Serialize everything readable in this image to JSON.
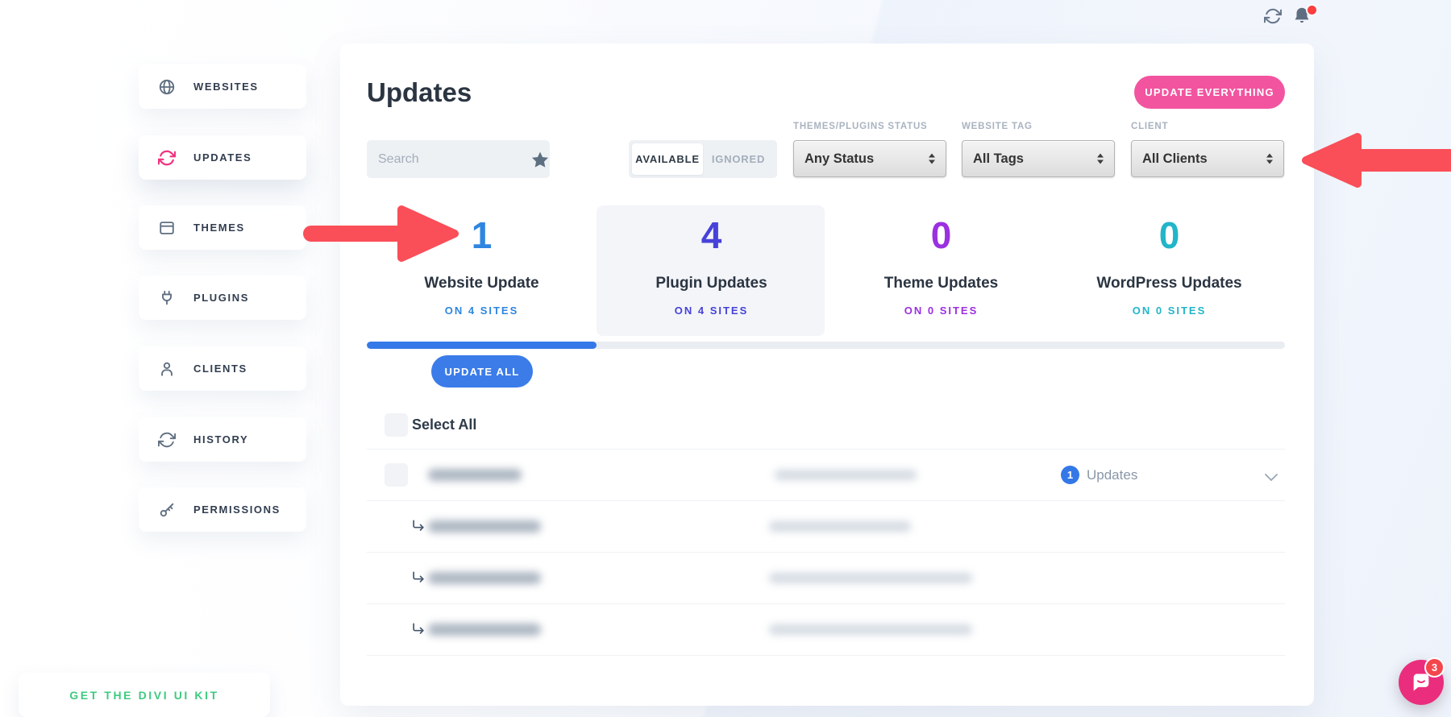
{
  "topbar": {
    "refresh_icon": "refresh-icon",
    "notifications_icon": "bell-icon",
    "has_notification_dot": true
  },
  "sidebar": {
    "items": [
      {
        "label": "WEBSITES",
        "icon": "globe-icon",
        "active": false
      },
      {
        "label": "UPDATES",
        "icon": "sync-icon",
        "active": true
      },
      {
        "label": "THEMES",
        "icon": "window-icon",
        "active": false
      },
      {
        "label": "PLUGINS",
        "icon": "plug-icon",
        "active": false
      },
      {
        "label": "CLIENTS",
        "icon": "user-icon",
        "active": false
      },
      {
        "label": "HISTORY",
        "icon": "history-icon",
        "active": false
      },
      {
        "label": "PERMISSIONS",
        "icon": "key-icon",
        "active": false
      }
    ],
    "footer_link_label": "GET THE DIVI UI KIT",
    "footer_link_color": "#3ecb80"
  },
  "header": {
    "title": "Updates",
    "update_everything_button": "UPDATE EVERYTHING",
    "update_everything_color": "#f2549f"
  },
  "filters": {
    "search": {
      "placeholder": "Search",
      "value": ""
    },
    "favorite_filter_icon": "star-icon",
    "status_toggle": {
      "options": [
        "AVAILABLE",
        "IGNORED"
      ],
      "selected": "AVAILABLE"
    },
    "dropdowns": [
      {
        "label": "THEMES/PLUGINS STATUS",
        "value": "Any Status"
      },
      {
        "label": "WEBSITE TAG",
        "value": "All Tags"
      },
      {
        "label": "CLIENT",
        "value": "All Clients"
      }
    ]
  },
  "stats": [
    {
      "count": "1",
      "label": "Website Update",
      "subtext": "ON 4 SITES",
      "color": "#2e86e0",
      "highlighted": false
    },
    {
      "count": "4",
      "label": "Plugin Updates",
      "subtext": "ON 4 SITES",
      "color": "#4742d9",
      "highlighted": true
    },
    {
      "count": "0",
      "label": "Theme Updates",
      "subtext": "ON 0 SITES",
      "color": "#9b30e0",
      "highlighted": false
    },
    {
      "count": "0",
      "label": "WordPress Updates",
      "subtext": "ON 0 SITES",
      "color": "#22b5c9",
      "highlighted": false
    }
  ],
  "progress_bar": {
    "percent": 25,
    "fill_color": "#3579e8",
    "track_color": "#e9ecf0"
  },
  "actions": {
    "update_all_button": "UPDATE ALL",
    "select_all_label": "Select All"
  },
  "updates_table": {
    "rows": [
      {
        "type": "site",
        "name_redacted": true,
        "detail_redacted": true,
        "updates_badge_count": "1",
        "updates_badge_label": "Updates",
        "expandable": true
      },
      {
        "type": "sub-update",
        "name_redacted": true,
        "detail_redacted": true
      },
      {
        "type": "sub-update",
        "name_redacted": true,
        "detail_redacted": true
      },
      {
        "type": "sub-update",
        "name_redacted": true,
        "detail_redacted": true
      }
    ]
  },
  "annotations": {
    "arrow_color": "#fa4e58",
    "arrows": [
      {
        "direction": "right",
        "points_at": "website-update-stat"
      },
      {
        "direction": "left",
        "points_at": "client-dropdown"
      }
    ]
  },
  "chat_widget": {
    "badge_count": "3",
    "bubble_color": "#eb2d7d"
  }
}
